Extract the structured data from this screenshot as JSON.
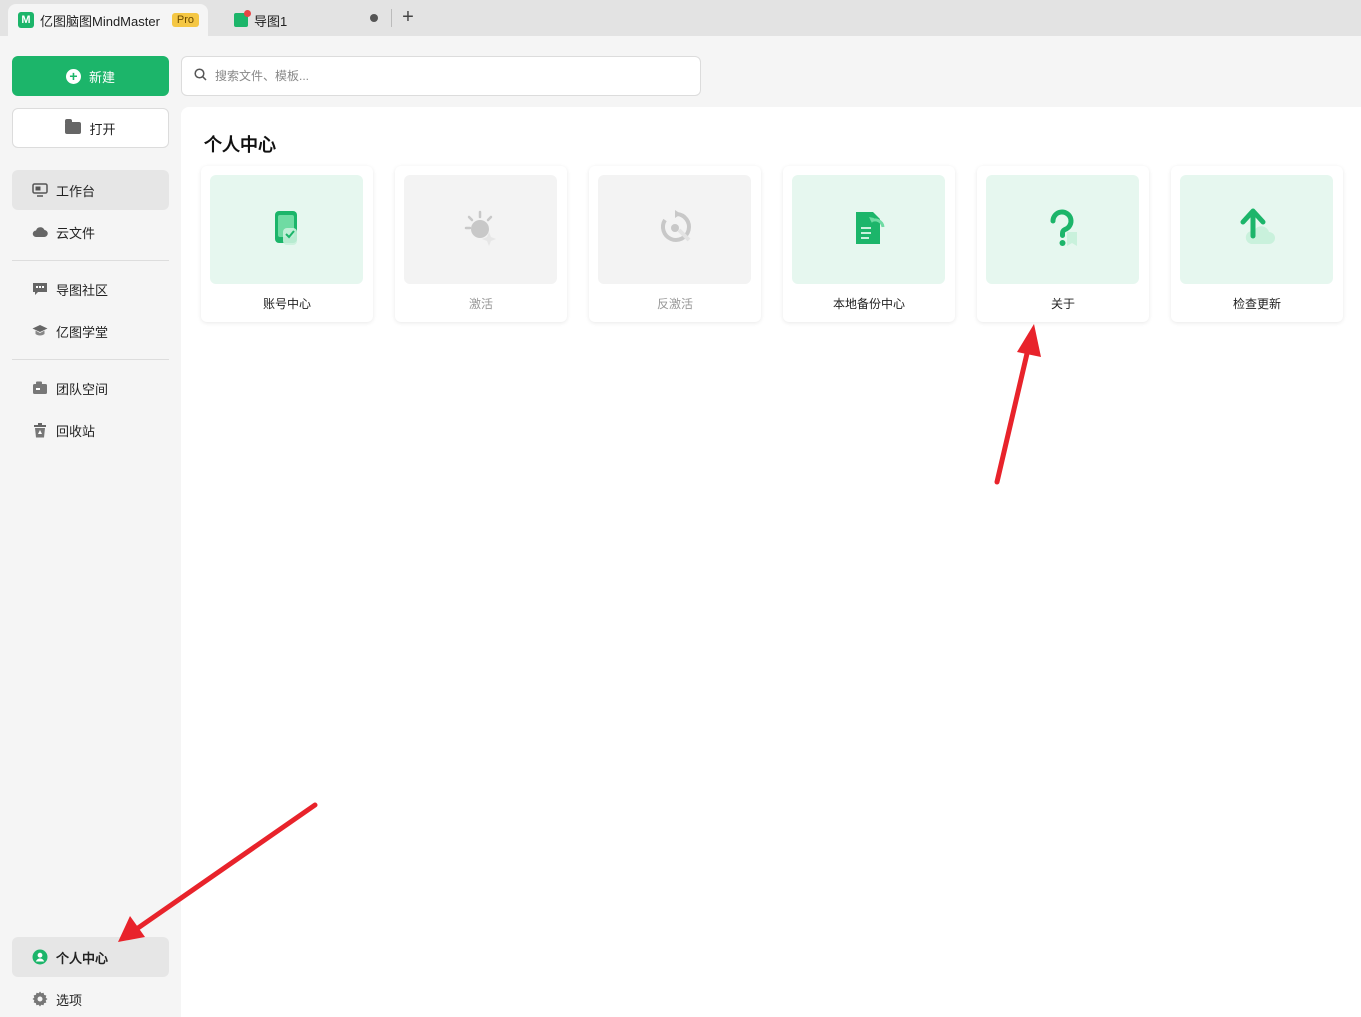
{
  "titlebar": {
    "app_tab_label": "亿图脑图MindMaster",
    "pro_badge": "Pro",
    "doc_tab_label": "导图1",
    "add_tab_symbol": "+"
  },
  "sidebar": {
    "new_label": "新建",
    "open_label": "打开",
    "items": [
      {
        "label": "工作台",
        "icon": "dashboard-icon"
      },
      {
        "label": "云文件",
        "icon": "cloud-icon"
      },
      {
        "label": "导图社区",
        "icon": "community-icon"
      },
      {
        "label": "亿图学堂",
        "icon": "graduation-cap-icon"
      },
      {
        "label": "团队空间",
        "icon": "team-space-icon"
      },
      {
        "label": "回收站",
        "icon": "trash-icon"
      }
    ],
    "personal_center": "个人中心",
    "options": "选项"
  },
  "search": {
    "placeholder": "搜索文件、模板..."
  },
  "main": {
    "title": "个人中心",
    "cards": [
      {
        "label": "账号中心",
        "icon": "account-icon",
        "enabled": true
      },
      {
        "label": "激活",
        "icon": "activate-icon",
        "enabled": false
      },
      {
        "label": "反激活",
        "icon": "deactivate-icon",
        "enabled": false
      },
      {
        "label": "本地备份中心",
        "icon": "local-backup-icon",
        "enabled": true
      },
      {
        "label": "关于",
        "icon": "about-icon",
        "enabled": true
      },
      {
        "label": "检查更新",
        "icon": "check-update-icon",
        "enabled": true
      }
    ]
  },
  "colors": {
    "brand_green": "#1cb56a",
    "card_green_bg": "#e6f7ef",
    "card_disabled_bg": "#f3f3f3",
    "annotation_red": "#e8232b",
    "pro_badge": "#f5c744"
  }
}
